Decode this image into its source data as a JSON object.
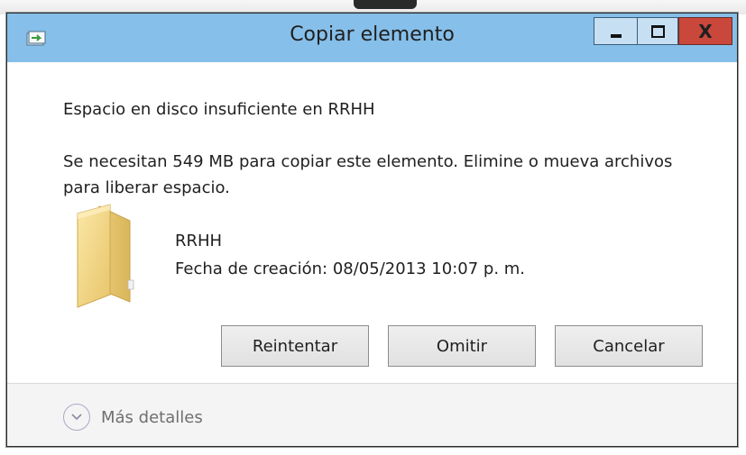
{
  "window": {
    "title": "Copiar elemento",
    "close_label": "X",
    "icon": "copy-arrow-icon"
  },
  "dialog": {
    "heading": "Espacio en disco insuficiente en RRHH",
    "message": "Se necesitan 549 MB para copiar este elemento. Elimine o mueva archivos para liberar espacio.",
    "item": {
      "icon": "folder-icon",
      "name": "RRHH",
      "date_line": "Fecha de creación: 08/05/2013 10:07 p. m."
    },
    "buttons": {
      "retry": "Reintentar",
      "skip": "Omitir",
      "cancel": "Cancelar"
    }
  },
  "footer": {
    "details_label": "Más detalles",
    "icon": "chevron-down-icon"
  }
}
